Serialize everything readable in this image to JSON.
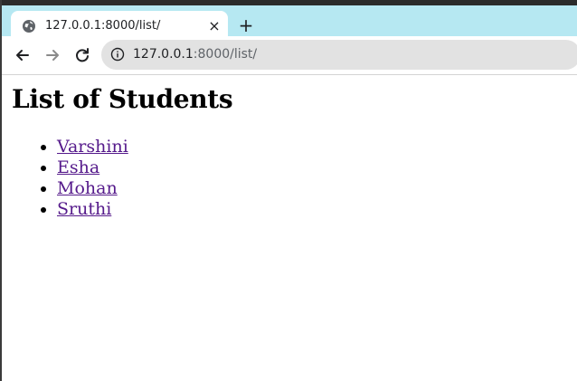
{
  "browser": {
    "tab": {
      "title": "127.0.0.1:8000/list/",
      "close_glyph": "×",
      "icon": "globe-icon"
    },
    "new_tab_glyph": "+",
    "nav": {
      "back_icon": "arrow-left-icon",
      "forward_icon": "arrow-right-icon",
      "reload_icon": "reload-icon"
    },
    "address": {
      "host": "127.0.0.1",
      "rest": ":8000/list/",
      "icon": "info-icon"
    },
    "colors": {
      "tabbar": "#b6e8f2",
      "omnibox": "#e2e2e2",
      "visited_link": "#551a8b"
    }
  },
  "page": {
    "heading": "List of Students",
    "students": [
      {
        "name": "Varshini"
      },
      {
        "name": "Esha"
      },
      {
        "name": "Mohan"
      },
      {
        "name": "Sruthi"
      }
    ]
  }
}
